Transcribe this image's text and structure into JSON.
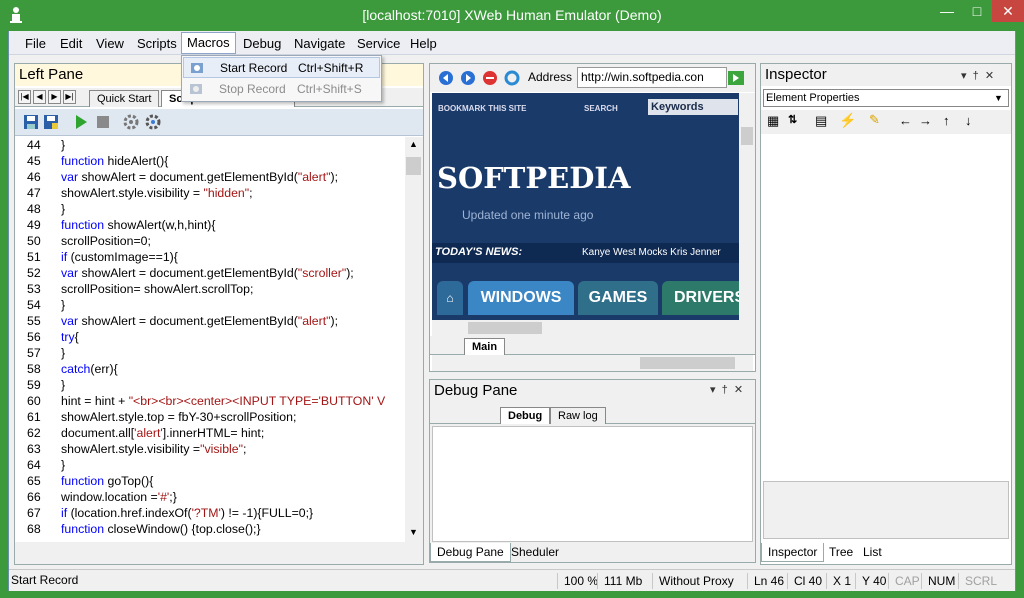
{
  "window": {
    "title": "[localhost:7010] XWeb Human Emulator (Demo)"
  },
  "menu": [
    "File",
    "Edit",
    "View",
    "Scripts",
    "Macros",
    "Debug",
    "Navigate",
    "Service",
    "Help"
  ],
  "macros_menu": [
    {
      "label": "Start Record",
      "shortcut": "Ctrl+Shift+R"
    },
    {
      "label": "Stop Record",
      "shortcut": "Ctrl+Shift+S"
    }
  ],
  "left_pane": {
    "title": "Left Pane",
    "tabs": [
      "Quick Start",
      "Softpedia test script.php"
    ],
    "code": [
      {
        "n": "44",
        "t": "}"
      },
      {
        "n": "45",
        "t": "function hideAlert(){"
      },
      {
        "n": "46",
        "t": "var showAlert = document.getElementById(\"alert\");"
      },
      {
        "n": "47",
        "t": "showAlert.style.visibility = \"hidden\";"
      },
      {
        "n": "48",
        "t": "}"
      },
      {
        "n": "49",
        "t": "function showAlert(w,h,hint){"
      },
      {
        "n": "50",
        "t": "scrollPosition=0;"
      },
      {
        "n": "51",
        "t": "if (customImage==1){"
      },
      {
        "n": "52",
        "t": "var showAlert = document.getElementById(\"scroller\");"
      },
      {
        "n": "53",
        "t": "scrollPosition= showAlert.scrollTop;"
      },
      {
        "n": "54",
        "t": "}"
      },
      {
        "n": "55",
        "t": "var showAlert = document.getElementById(\"alert\");"
      },
      {
        "n": "56",
        "t": "try{"
      },
      {
        "n": "57",
        "t": "}"
      },
      {
        "n": "58",
        "t": "catch(err){"
      },
      {
        "n": "59",
        "t": "}"
      },
      {
        "n": "60",
        "t": "hint = hint + \"<br><br><center><INPUT TYPE='BUTTON' V"
      },
      {
        "n": "61",
        "t": "showAlert.style.top = fbY-30+scrollPosition;"
      },
      {
        "n": "62",
        "t": "document.all['alert'].innerHTML= hint;"
      },
      {
        "n": "63",
        "t": "showAlert.style.visibility =\"visible\";"
      },
      {
        "n": "64",
        "t": "}"
      },
      {
        "n": "65",
        "t": "function goTop(){"
      },
      {
        "n": "66",
        "t": "window.location ='#';}"
      },
      {
        "n": "67",
        "t": "if (location.href.indexOf('?TM') != -1){FULL=0;}"
      },
      {
        "n": "68",
        "t": "function closeWindow() {top.close();}"
      }
    ]
  },
  "browser": {
    "address_label": "Address",
    "address_value": "http://win.softpedia.con",
    "bookmark": "BOOKMARK THIS SITE",
    "search": "SEARCH",
    "keywords": "Keywords",
    "logo": "SOFTPEDIA",
    "updated": "Updated one minute ago",
    "news_label": "TODAY'S NEWS:",
    "news_text": "Kanye West Mocks Kris Jenner",
    "nav": [
      "WINDOWS",
      "GAMES",
      "DRIVERS"
    ],
    "tab": "Main"
  },
  "debug_pane": {
    "title": "Debug Pane",
    "tabs": [
      "Debug",
      "Raw log"
    ]
  },
  "bottom_tabs_mid": [
    "Debug Pane",
    "Sheduler"
  ],
  "inspector": {
    "title": "Inspector",
    "dropdown": "Element Properties",
    "bottom_tabs": [
      "Inspector",
      "Tree",
      "List"
    ]
  },
  "status": {
    "left": "Start Record",
    "zoom": "100 %",
    "memory": "111 Mb",
    "proxy": "Without Proxy",
    "ln": "Ln 46",
    "col": "Cl 40",
    "x": "X 1",
    "y": "Y 40",
    "cap": "CAP",
    "num": "NUM",
    "scrl": "SCRL"
  },
  "colors": {
    "titlebar": "#3c9a3c",
    "keyword": "#0000ff",
    "string": "#a31515"
  }
}
